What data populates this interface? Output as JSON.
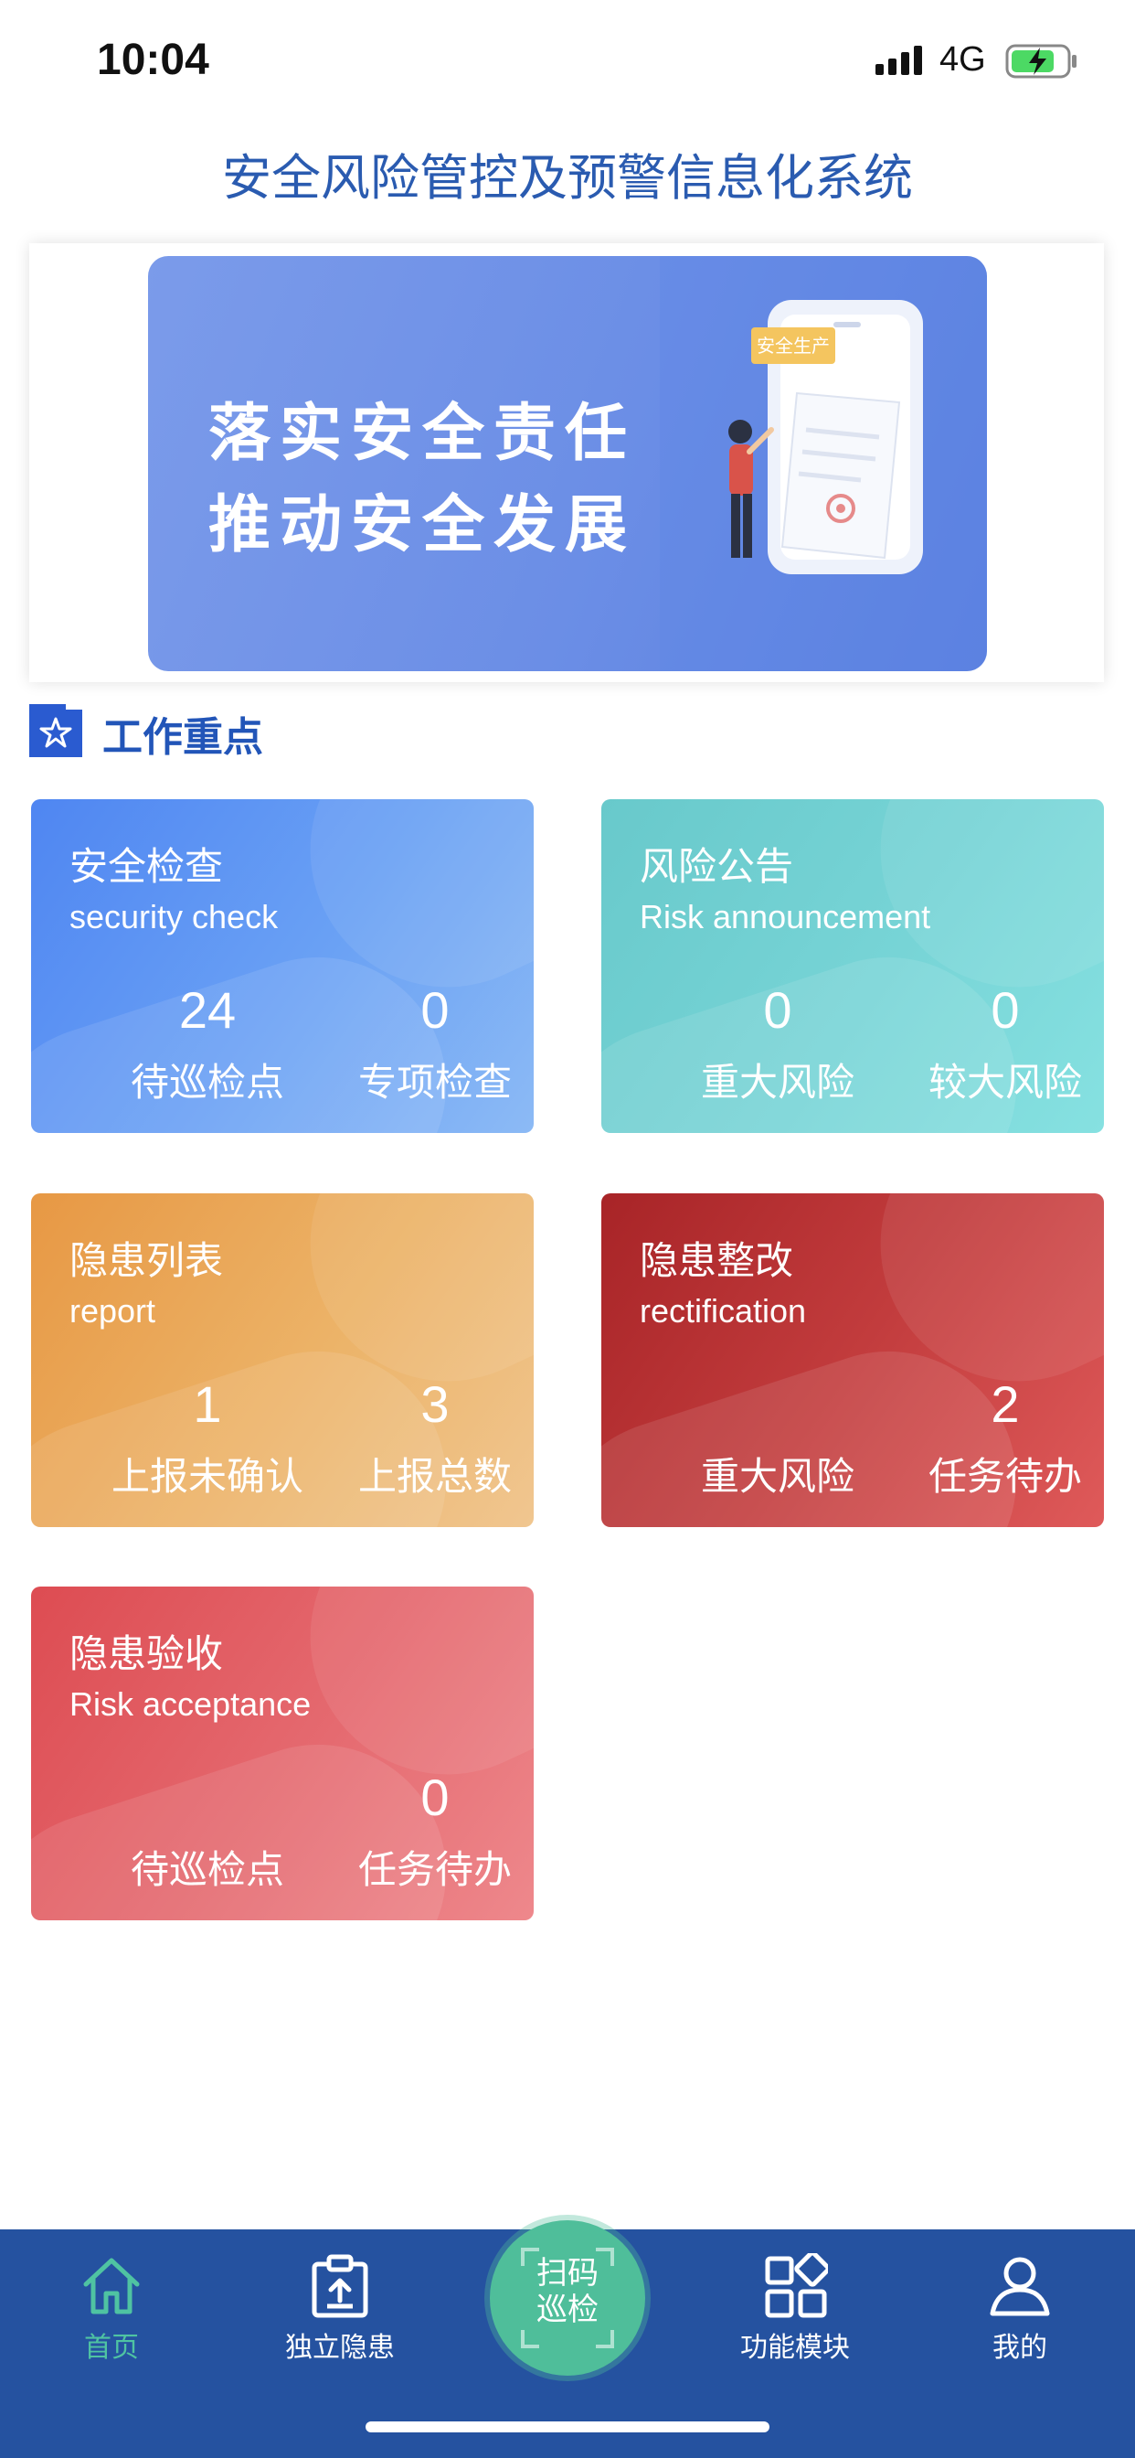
{
  "status": {
    "time": "10:04",
    "network": "4G"
  },
  "header": {
    "title": "安全风险管控及预警信息化系统"
  },
  "banner": {
    "line1": "落实安全责任",
    "line2": "推动安全发展",
    "tag": "安全生产"
  },
  "section": {
    "title": "工作重点",
    "icon": "star-badge-icon"
  },
  "cards": [
    {
      "title": "安全检查",
      "subtitle": "security check",
      "stats": [
        {
          "value": "24",
          "label": "待巡检点"
        },
        {
          "value": "0",
          "label": "专项检查"
        }
      ]
    },
    {
      "title": "风险公告",
      "subtitle": "Risk announcement",
      "stats": [
        {
          "value": "0",
          "label": "重大风险"
        },
        {
          "value": "0",
          "label": "较大风险"
        }
      ]
    },
    {
      "title": "隐患列表",
      "subtitle": "report",
      "stats": [
        {
          "value": "1",
          "label": "上报未确认"
        },
        {
          "value": "3",
          "label": "上报总数"
        }
      ]
    },
    {
      "title": "隐患整改",
      "subtitle": "rectification",
      "stats": [
        {
          "value": "",
          "label": "重大风险"
        },
        {
          "value": "2",
          "label": "任务待办"
        }
      ]
    },
    {
      "title": "隐患验收",
      "subtitle": "Risk acceptance",
      "stats": [
        {
          "value": "",
          "label": "待巡检点"
        },
        {
          "value": "0",
          "label": "任务待办"
        }
      ]
    }
  ],
  "tabbar": {
    "home": {
      "label": "首页",
      "icon": "home-icon"
    },
    "hazard": {
      "label": "独立隐患",
      "icon": "clipboard-upload-icon"
    },
    "scan": {
      "label": "扫码\n巡检",
      "icon": "scan-frame-icon"
    },
    "modules": {
      "label": "功能模块",
      "icon": "grid-modules-icon"
    },
    "me": {
      "label": "我的",
      "icon": "user-icon"
    }
  },
  "colors": {
    "primary": "#2552a0",
    "accent_green": "#4fbe9a",
    "title_blue": "#2a5bb0"
  }
}
